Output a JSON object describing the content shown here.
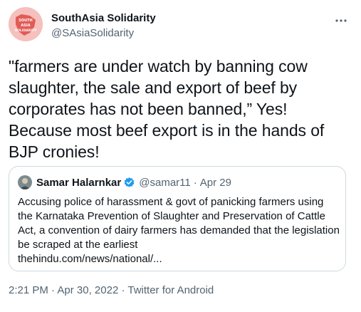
{
  "author": {
    "display_name": "SouthAsia Solidarity",
    "handle": "@SAsiaSolidarity",
    "avatar_text": "SOUTH ASIA SOLIDARITY"
  },
  "tweet": {
    "text": "\"farmers are under watch by banning cow slaughter, the sale and export of beef by corporates has not been banned,” Yes! Because most beef export is in the hands of BJP cronies!"
  },
  "quoted_tweet": {
    "display_name": "Samar Halarnkar",
    "handle": "@samar11",
    "separator": "·",
    "date": "Apr 29",
    "text": "Accusing police of harassment & govt of panicking farmers using the Karnataka Prevention of Slaughter and Preservation of Cattle Act, a convention of dairy farmers has demanded that the legislation be scraped at the earliest",
    "link": "thehindu.com/news/national/..."
  },
  "meta": {
    "time": "2:21 PM",
    "sep1": "·",
    "date": "Apr 30, 2022",
    "sep2": "·",
    "source": "Twitter for Android"
  },
  "colors": {
    "text_primary": "#0f1419",
    "text_secondary": "#536471",
    "verified": "#1d9bf0",
    "border": "#cfd9de",
    "avatar_bg": "#f5c0bd"
  },
  "icons": {
    "more": "more-horizontal-icon",
    "verified": "verified-badge-icon"
  }
}
